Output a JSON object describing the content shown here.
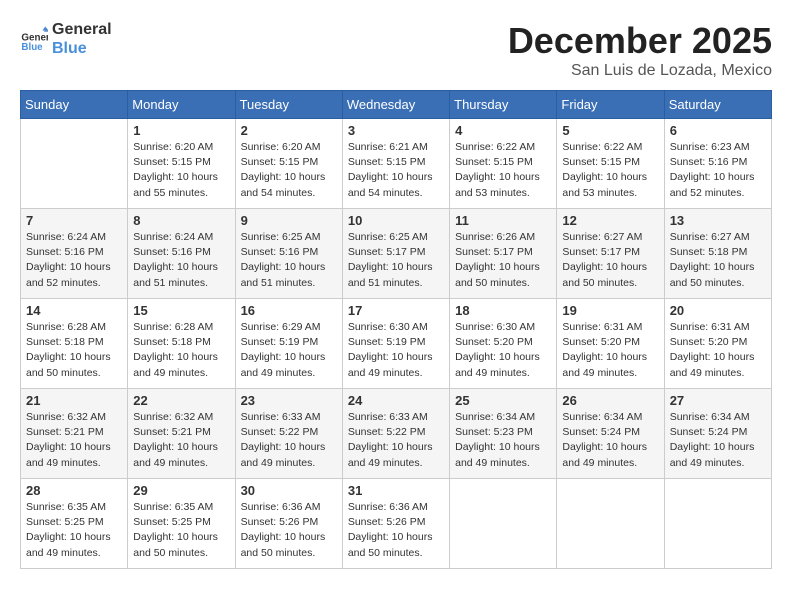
{
  "logo": {
    "text_general": "General",
    "text_blue": "Blue"
  },
  "title": "December 2025",
  "location": "San Luis de Lozada, Mexico",
  "weekdays": [
    "Sunday",
    "Monday",
    "Tuesday",
    "Wednesday",
    "Thursday",
    "Friday",
    "Saturday"
  ],
  "weeks": [
    [
      {
        "day": null,
        "info": null
      },
      {
        "day": "1",
        "info": "Sunrise: 6:20 AM\nSunset: 5:15 PM\nDaylight: 10 hours\nand 55 minutes."
      },
      {
        "day": "2",
        "info": "Sunrise: 6:20 AM\nSunset: 5:15 PM\nDaylight: 10 hours\nand 54 minutes."
      },
      {
        "day": "3",
        "info": "Sunrise: 6:21 AM\nSunset: 5:15 PM\nDaylight: 10 hours\nand 54 minutes."
      },
      {
        "day": "4",
        "info": "Sunrise: 6:22 AM\nSunset: 5:15 PM\nDaylight: 10 hours\nand 53 minutes."
      },
      {
        "day": "5",
        "info": "Sunrise: 6:22 AM\nSunset: 5:15 PM\nDaylight: 10 hours\nand 53 minutes."
      },
      {
        "day": "6",
        "info": "Sunrise: 6:23 AM\nSunset: 5:16 PM\nDaylight: 10 hours\nand 52 minutes."
      }
    ],
    [
      {
        "day": "7",
        "info": "Sunrise: 6:24 AM\nSunset: 5:16 PM\nDaylight: 10 hours\nand 52 minutes."
      },
      {
        "day": "8",
        "info": "Sunrise: 6:24 AM\nSunset: 5:16 PM\nDaylight: 10 hours\nand 51 minutes."
      },
      {
        "day": "9",
        "info": "Sunrise: 6:25 AM\nSunset: 5:16 PM\nDaylight: 10 hours\nand 51 minutes."
      },
      {
        "day": "10",
        "info": "Sunrise: 6:25 AM\nSunset: 5:17 PM\nDaylight: 10 hours\nand 51 minutes."
      },
      {
        "day": "11",
        "info": "Sunrise: 6:26 AM\nSunset: 5:17 PM\nDaylight: 10 hours\nand 50 minutes."
      },
      {
        "day": "12",
        "info": "Sunrise: 6:27 AM\nSunset: 5:17 PM\nDaylight: 10 hours\nand 50 minutes."
      },
      {
        "day": "13",
        "info": "Sunrise: 6:27 AM\nSunset: 5:18 PM\nDaylight: 10 hours\nand 50 minutes."
      }
    ],
    [
      {
        "day": "14",
        "info": "Sunrise: 6:28 AM\nSunset: 5:18 PM\nDaylight: 10 hours\nand 50 minutes."
      },
      {
        "day": "15",
        "info": "Sunrise: 6:28 AM\nSunset: 5:18 PM\nDaylight: 10 hours\nand 49 minutes."
      },
      {
        "day": "16",
        "info": "Sunrise: 6:29 AM\nSunset: 5:19 PM\nDaylight: 10 hours\nand 49 minutes."
      },
      {
        "day": "17",
        "info": "Sunrise: 6:30 AM\nSunset: 5:19 PM\nDaylight: 10 hours\nand 49 minutes."
      },
      {
        "day": "18",
        "info": "Sunrise: 6:30 AM\nSunset: 5:20 PM\nDaylight: 10 hours\nand 49 minutes."
      },
      {
        "day": "19",
        "info": "Sunrise: 6:31 AM\nSunset: 5:20 PM\nDaylight: 10 hours\nand 49 minutes."
      },
      {
        "day": "20",
        "info": "Sunrise: 6:31 AM\nSunset: 5:20 PM\nDaylight: 10 hours\nand 49 minutes."
      }
    ],
    [
      {
        "day": "21",
        "info": "Sunrise: 6:32 AM\nSunset: 5:21 PM\nDaylight: 10 hours\nand 49 minutes."
      },
      {
        "day": "22",
        "info": "Sunrise: 6:32 AM\nSunset: 5:21 PM\nDaylight: 10 hours\nand 49 minutes."
      },
      {
        "day": "23",
        "info": "Sunrise: 6:33 AM\nSunset: 5:22 PM\nDaylight: 10 hours\nand 49 minutes."
      },
      {
        "day": "24",
        "info": "Sunrise: 6:33 AM\nSunset: 5:22 PM\nDaylight: 10 hours\nand 49 minutes."
      },
      {
        "day": "25",
        "info": "Sunrise: 6:34 AM\nSunset: 5:23 PM\nDaylight: 10 hours\nand 49 minutes."
      },
      {
        "day": "26",
        "info": "Sunrise: 6:34 AM\nSunset: 5:24 PM\nDaylight: 10 hours\nand 49 minutes."
      },
      {
        "day": "27",
        "info": "Sunrise: 6:34 AM\nSunset: 5:24 PM\nDaylight: 10 hours\nand 49 minutes."
      }
    ],
    [
      {
        "day": "28",
        "info": "Sunrise: 6:35 AM\nSunset: 5:25 PM\nDaylight: 10 hours\nand 49 minutes."
      },
      {
        "day": "29",
        "info": "Sunrise: 6:35 AM\nSunset: 5:25 PM\nDaylight: 10 hours\nand 50 minutes."
      },
      {
        "day": "30",
        "info": "Sunrise: 6:36 AM\nSunset: 5:26 PM\nDaylight: 10 hours\nand 50 minutes."
      },
      {
        "day": "31",
        "info": "Sunrise: 6:36 AM\nSunset: 5:26 PM\nDaylight: 10 hours\nand 50 minutes."
      },
      {
        "day": null,
        "info": null
      },
      {
        "day": null,
        "info": null
      },
      {
        "day": null,
        "info": null
      }
    ]
  ]
}
